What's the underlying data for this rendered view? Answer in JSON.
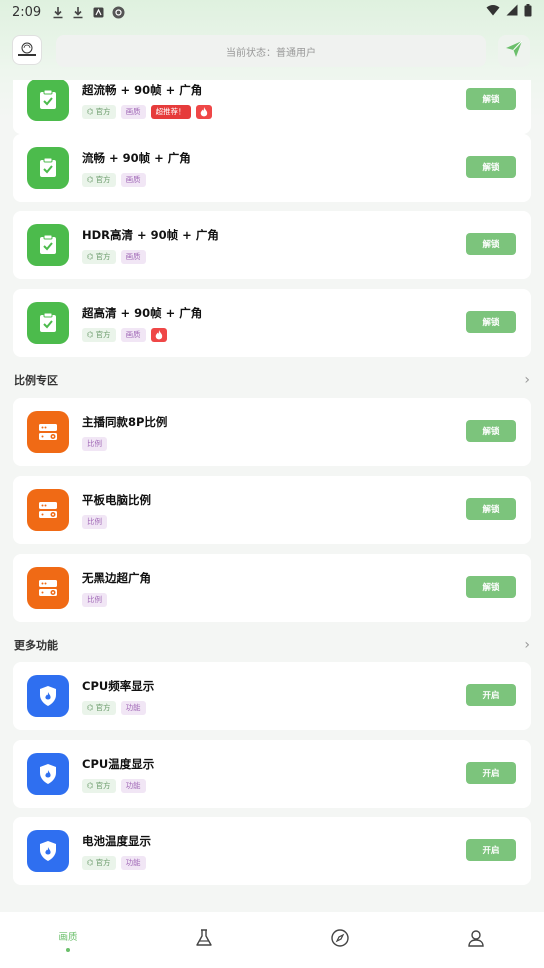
{
  "status_bar": {
    "time": "2:09"
  },
  "header": {
    "status_text": "当前状态：普通用户"
  },
  "cards_top": [
    {
      "title": "超流畅 + 90帧 + 广角",
      "tags": [
        "官方",
        "画质",
        "超推荐！"
      ],
      "fire": true,
      "action": "解锁"
    },
    {
      "title": "流畅 + 90帧 + 广角",
      "tags": [
        "官方",
        "画质"
      ],
      "fire": false,
      "action": "解锁"
    },
    {
      "title": "HDR高清 + 90帧 + 广角",
      "tags": [
        "官方",
        "画质"
      ],
      "fire": false,
      "action": "解锁"
    },
    {
      "title": "超高清 + 90帧 + 广角",
      "tags": [
        "官方",
        "画质"
      ],
      "fire": true,
      "action": "解锁"
    }
  ],
  "section_ratio": {
    "title": "比例专区"
  },
  "cards_ratio": [
    {
      "title": "主播同款8P比例",
      "tag": "比例",
      "action": "解锁"
    },
    {
      "title": "平板电脑比例",
      "tag": "比例",
      "action": "解锁"
    },
    {
      "title": "无黑边超广角",
      "tag": "比例",
      "action": "解锁"
    }
  ],
  "section_more": {
    "title": "更多功能"
  },
  "cards_more": [
    {
      "title": "CPU频率显示",
      "tags": [
        "官方",
        "功能"
      ],
      "action": "开启"
    },
    {
      "title": "CPU温度显示",
      "tags": [
        "官方",
        "功能"
      ],
      "action": "开启"
    },
    {
      "title": "电池温度显示",
      "tags": [
        "官方",
        "功能"
      ],
      "action": "开启"
    }
  ],
  "bottom_nav": {
    "active_label": "画质"
  },
  "colors": {
    "accent_green": "#7cc47c",
    "icon_green": "#4cbb4c",
    "icon_orange": "#f06a15",
    "icon_blue": "#2f6ff0"
  }
}
